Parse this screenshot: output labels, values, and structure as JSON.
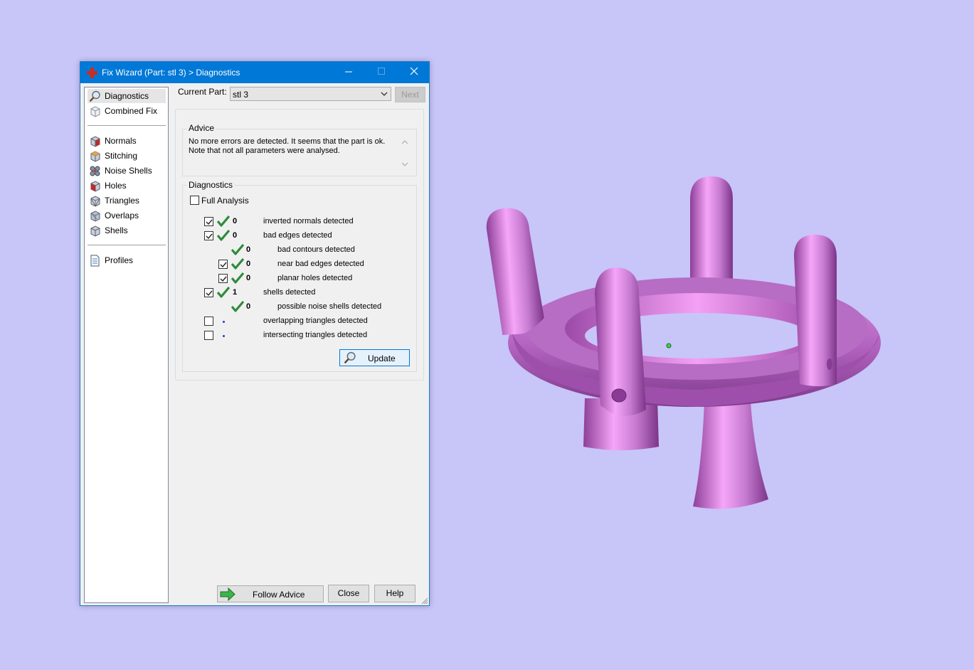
{
  "window": {
    "title": "Fix Wizard (Part: stl 3) > Diagnostics",
    "minimize_label": "—",
    "maximize_label": "☐",
    "close_label": "✕"
  },
  "sidebar": {
    "items": [
      {
        "label": "Diagnostics",
        "icon": "magnifier-icon",
        "selected": true
      },
      {
        "label": "Combined Fix",
        "icon": "cube-icon"
      },
      {
        "label": "Normals",
        "icon": "normals-cube-icon"
      },
      {
        "label": "Stitching",
        "icon": "stitching-cube-icon"
      },
      {
        "label": "Noise Shells",
        "icon": "noise-shells-icon"
      },
      {
        "label": "Holes",
        "icon": "holes-cube-icon"
      },
      {
        "label": "Triangles",
        "icon": "triangles-cube-icon"
      },
      {
        "label": "Overlaps",
        "icon": "overlaps-cube-icon"
      },
      {
        "label": "Shells",
        "icon": "shells-cube-icon"
      },
      {
        "label": "Profiles",
        "icon": "document-icon"
      }
    ]
  },
  "main": {
    "current_part_label": "Current Part:",
    "current_part_value": "stl 3",
    "next_label": "Next",
    "advice_title": "Advice",
    "advice_line1": "No more errors are detected. It seems that the part is ok.",
    "advice_line2": "Note that not all parameters were analysed.",
    "diagnostics_title": "Diagnostics",
    "full_analysis_label": "Full Analysis",
    "full_analysis_checked": false,
    "rows": [
      {
        "checked": true,
        "status": "ok",
        "count": "0",
        "text": "inverted normals detected"
      },
      {
        "checked": true,
        "status": "ok",
        "count": "0",
        "text": "bad edges detected"
      },
      {
        "status": "ok",
        "count": "0",
        "text": "bad contours detected"
      },
      {
        "checked": true,
        "status": "ok",
        "count": "0",
        "text": "near bad edges detected"
      },
      {
        "checked": true,
        "status": "ok",
        "count": "0",
        "text": "planar holes detected"
      },
      {
        "checked": true,
        "status": "ok",
        "count": "1",
        "text": "shells detected"
      },
      {
        "status": "ok",
        "count": "0",
        "text": "possible noise shells detected"
      },
      {
        "checked": false,
        "status": "not-analysed",
        "count": "",
        "text": "overlapping triangles detected"
      },
      {
        "checked": false,
        "status": "not-analysed",
        "count": "",
        "text": "intersecting triangles detected"
      }
    ],
    "update_label": "Update",
    "follow_advice_label": "Follow Advice",
    "close_label": "Close",
    "help_label": "Help"
  },
  "colors": {
    "background": "#c8c5f9",
    "titlebar": "#0078d7",
    "model": "#c77ad0",
    "check_green": "#2e8b3a"
  }
}
